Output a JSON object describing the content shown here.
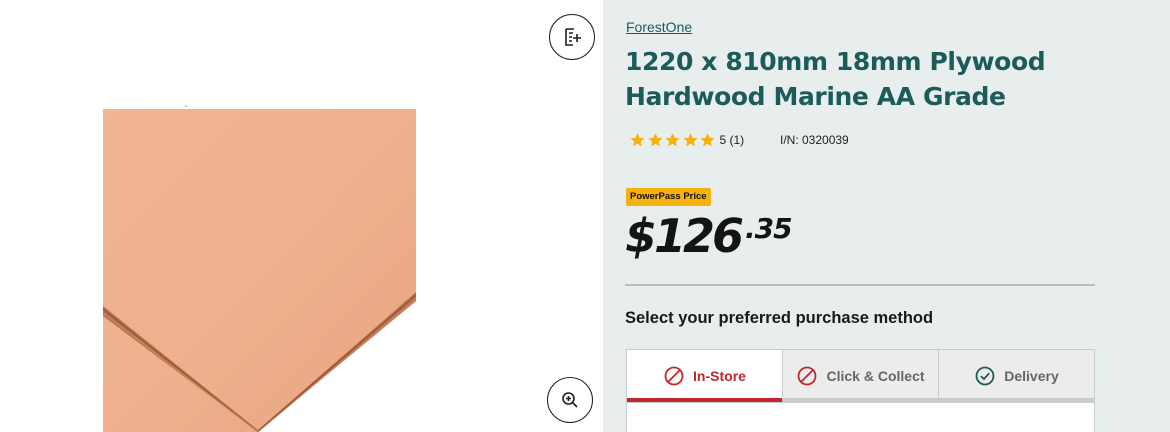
{
  "product": {
    "brand": "ForestOne",
    "title": "1220 x 810mm 18mm Plywood Hardwood Marine AA Grade",
    "rating_count": "5 (1)",
    "rating_stars": 5,
    "item_number": "I/N: 0320039"
  },
  "pricing": {
    "badge": "PowerPass Price",
    "price_main": "$126",
    "price_cents": ".35"
  },
  "purchase": {
    "heading": "Select your preferred purchase method",
    "tabs": [
      {
        "label": "In-Store",
        "state": "unavailable",
        "active": true
      },
      {
        "label": "Click & Collect",
        "state": "unavailable",
        "active": false
      },
      {
        "label": "Delivery",
        "state": "available",
        "active": false
      }
    ]
  },
  "icons": {
    "compare": "compare-add-icon",
    "zoom": "zoom-in-icon",
    "star": "star-icon",
    "unavailable": "prohibited-icon",
    "available": "check-circle-icon"
  },
  "colors": {
    "brand_teal": "#1b5c5a",
    "star": "#f5b10c",
    "badge": "#f5b10c",
    "accent_red": "#c0272d",
    "panel_bg": "#e8eded"
  }
}
